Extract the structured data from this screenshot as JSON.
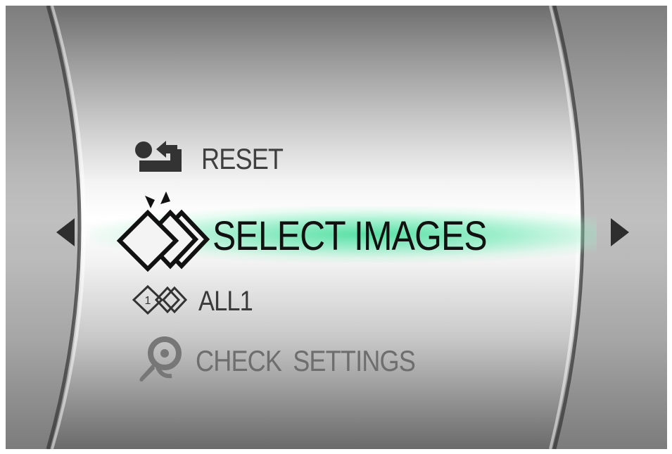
{
  "menu": {
    "items": [
      {
        "id": "reset",
        "label": "RESET",
        "icon": "reset-icon",
        "selected": false
      },
      {
        "id": "select_images",
        "label": "SELECT IMAGES",
        "icon": "select-images-icon",
        "selected": true
      },
      {
        "id": "all1",
        "label": "ALL1",
        "icon": "all-one-icon",
        "selected": false
      },
      {
        "id": "check_settings",
        "label": "CHECK  SETTINGS",
        "icon": "check-settings-icon",
        "selected": false
      }
    ]
  },
  "navigation": {
    "left_arrow": "triangle-left-icon",
    "right_arrow": "triangle-right-icon"
  },
  "colors": {
    "highlight": "#3cdc96",
    "selected_text": "#111111",
    "normal_text": "#3f3f3f",
    "dim_text": "#6e6e6e"
  }
}
